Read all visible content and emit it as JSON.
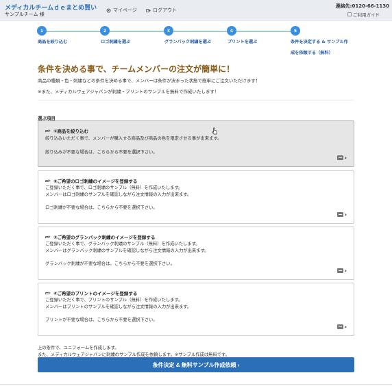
{
  "header": {
    "brand": "メディカルチームｄｅまとめ買い",
    "team": "サンプルチーム 様",
    "mypage": "マイページ",
    "logout": "ログアウト",
    "contact": "連絡先:0120-66-1130",
    "guide": "ご利用ガイド"
  },
  "steps": [
    {
      "num": "1",
      "label": "商品を絞り込む",
      "label2": ""
    },
    {
      "num": "2",
      "label": "ロゴ刺繍を選ぶ",
      "label2": ""
    },
    {
      "num": "3",
      "label": "グランバック刺繍を選ぶ",
      "label2": ""
    },
    {
      "num": "4",
      "label": "プリントを選ぶ",
      "label2": ""
    },
    {
      "num": "5",
      "label": "条件を決定する & サンプル作",
      "label2": "成を依頼する（無料）"
    }
  ],
  "main": {
    "title": "条件を決める事で、チームメンバーの注文が簡単に！",
    "desc1": "商品の種類・色・刺繍などの条件を決める事で、メンバーは条件が決まった状態で簡単にご注文いただけます！",
    "desc2": "※また、メディカルウェアジャパンが刺繍・プリントのサンプルを無料で作成いたします！",
    "section_label": "選ぶ項目"
  },
  "cards": [
    {
      "title": "①商品を絞り込む",
      "line1": "絞り込みいただく事で、メンバーが購入する商品及び商品の色を限定させる事が出来ます。",
      "line2": "",
      "line3": "絞り込みが不要な場合は、こちらから不要を選択下さい。"
    },
    {
      "title": "②ご希望のロゴ刺繍のイメージを登録する",
      "line1": "ご登録いただく事で、ロゴ刺繍のサンプル（無料）を作成いたします。",
      "line2": "メンバーはロゴ刺繍のサンプルを確認しながら注文情報の入力が出来ます。",
      "line3": "ロゴ刺繍が不要な場合は、こちらから不要を選択下さい。"
    },
    {
      "title": "③ご希望のグランバック刺繍のイメージを登録する",
      "line1": "ご登録いただく事で、グランバック刺繍のサンプル（無料）を作成いたします。",
      "line2": "メンバーはグランバック刺繍のサンプルを確認しながら注文情報の入力が出来ます。",
      "line3": "グランバック刺繍が不要な場合は、こちらから不要を選択下さい。"
    },
    {
      "title": "④ご希望のプリントのイメージを登録する",
      "line1": "ご登録いただく事で、プリントのサンプル（無料）を作成いたします。",
      "line2": "メンバーはプリントのサンプルを確認しながら注文情報の入力が出来ます。",
      "line3": "プリントが不要な場合は、こちらから不要を選択下さい。"
    }
  ],
  "footer": {
    "line1": "上の条件で、ユニフォームを作成します。",
    "line2": "また、メディカルウェアジャパンに刺繍のサンプル作成を依頼します。※サンプル作成は無料です。",
    "submit": "条件決定 & 無料サンプル作成依頼 ›"
  },
  "colors": {
    "accent": "#3a8ee0",
    "button": "#2a6fb8",
    "title": "#8a5a18",
    "selected_card": "#e6e6e6"
  }
}
